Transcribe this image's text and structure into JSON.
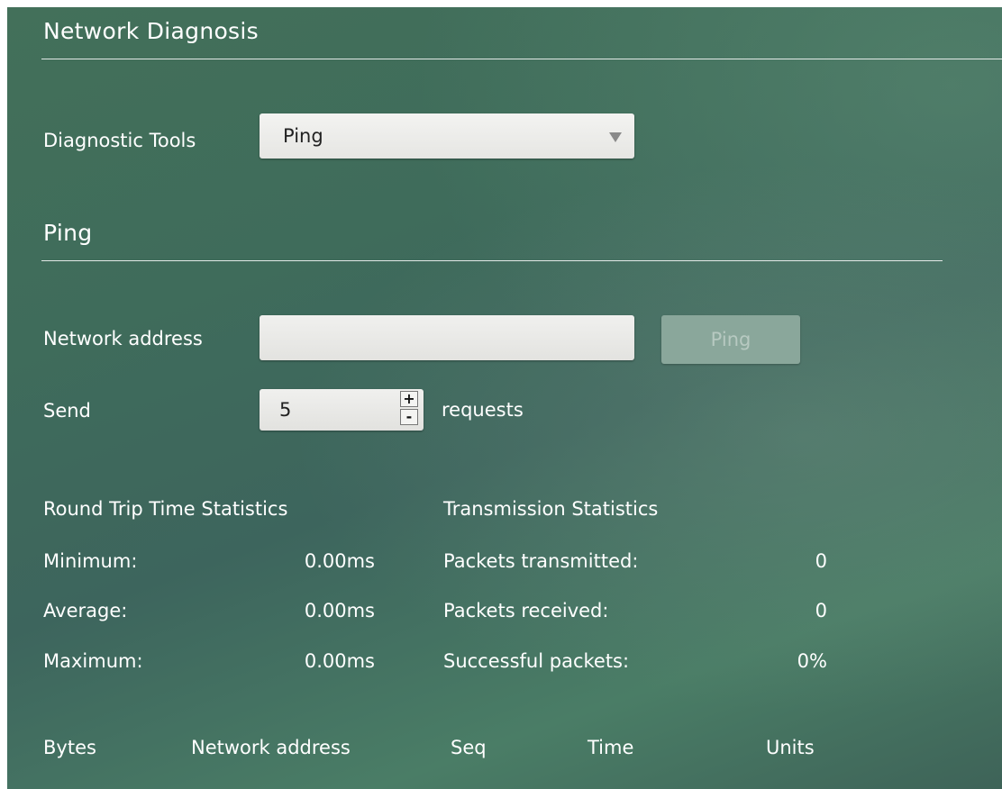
{
  "page": {
    "title": "Network Diagnosis"
  },
  "tools": {
    "label": "Diagnostic Tools",
    "selected": "Ping"
  },
  "ping": {
    "section_title": "Ping",
    "address_label": "Network address",
    "address_value": "",
    "ping_button": "Ping",
    "send_label": "Send",
    "send_count": "5",
    "requests_label": "requests"
  },
  "rtt": {
    "title": "Round Trip Time Statistics",
    "rows": [
      {
        "label": "Minimum:",
        "value": "0.00ms"
      },
      {
        "label": "Average:",
        "value": "0.00ms"
      },
      {
        "label": "Maximum:",
        "value": "0.00ms"
      }
    ]
  },
  "transmission": {
    "title": "Transmission Statistics",
    "rows": [
      {
        "label": "Packets transmitted:",
        "value": "0"
      },
      {
        "label": "Packets received:",
        "value": "0"
      },
      {
        "label": "Successful packets:",
        "value": "0%"
      }
    ]
  },
  "results_table": {
    "columns": [
      "Bytes",
      "Network address",
      "Seq",
      "Time",
      "Units"
    ]
  },
  "icons": {
    "dropdown": "chevron-down-icon",
    "increment": "plus-icon",
    "decrement": "minus-icon"
  }
}
